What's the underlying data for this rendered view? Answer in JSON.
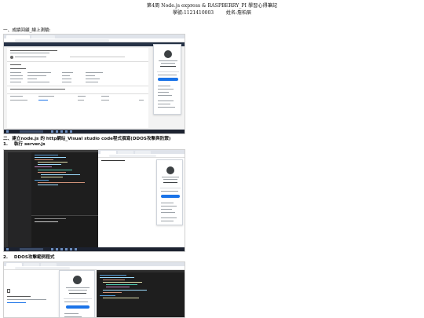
{
  "document": {
    "title": "第4周 Node.js express & RASPBERRY_PI 學習心得筆記",
    "student_id": "學號:1121410003",
    "student_name": "姓名:詹柏辰"
  },
  "sections": [
    {
      "heading": "一、成績回顧_線上測驗:"
    },
    {
      "heading": "二、建立node.js 的 http網站_Visual studio code程式撰寫(DDOS攻擊與防禦)"
    }
  ],
  "steps": [
    {
      "number": "1.",
      "label": "執行 server.js"
    },
    {
      "number": "2.",
      "label": "DDOS攻擊範例程式"
    }
  ],
  "colors": {
    "accent": "#1a73e8",
    "editor_bg": "#1e1e1e",
    "taskbar": "#1c2230"
  }
}
